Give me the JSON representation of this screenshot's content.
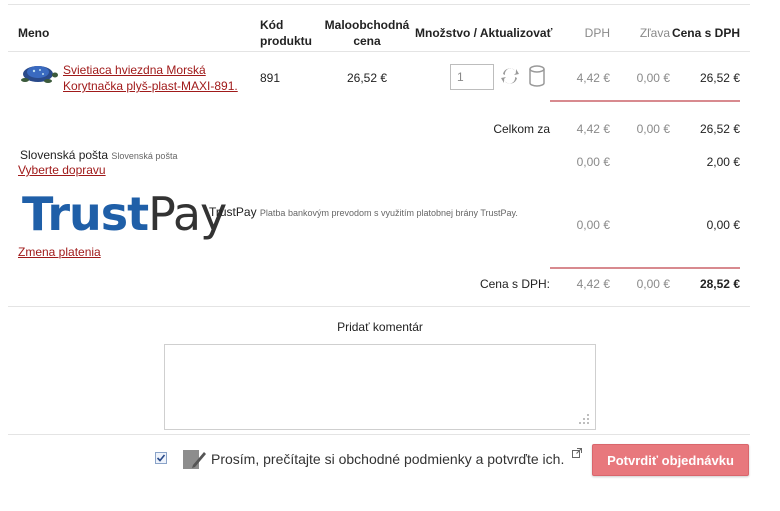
{
  "table": {
    "headers": {
      "name": "Meno",
      "code_l1": "Kód",
      "code_l2": "produktu",
      "price_l1": "Maloobchodná",
      "price_l2": "cena",
      "qty": "Množstvo / Aktualizovať",
      "vat": "DPH",
      "discount": "Zľava",
      "total": "Cena s DPH"
    },
    "item": {
      "name_l1": "Svietiaca hviezdna Morská",
      "name_l2": "Korytnačka plyš-plast-MAXI-891.",
      "code": "891",
      "price": "26,52 €",
      "qty": "1",
      "vat": "4,42 €",
      "discount": "0,00 €",
      "total": "26,52 €"
    }
  },
  "subtotal": {
    "label": "Celkom za",
    "vat": "4,42 €",
    "discount": "0,00 €",
    "total": "26,52 €"
  },
  "shipping": {
    "name": "Slovenská pošta",
    "desc": "Slovenská pošta",
    "link": "Vyberte dopravu",
    "vat": "0,00 €",
    "total": "2,00 €"
  },
  "payment": {
    "logo_trust": "Trust",
    "logo_pay": "Pay",
    "name": "TrustPay",
    "desc": "Platba bankovým prevodom s využitím platobnej brány TrustPay.",
    "link": "Zmena platenia",
    "vat": "0,00 €",
    "total": "0,00 €"
  },
  "grand": {
    "label": "Cena s DPH:",
    "vat": "4,42 €",
    "discount": "0,00 €",
    "total": "28,52 €"
  },
  "comment": {
    "label": "Pridať komentár"
  },
  "terms": {
    "text": "Prosím, prečítajte si obchodné podmienky a potvrďte ich.",
    "checked": true
  },
  "confirm_button": "Potvrdiť objednávku",
  "colors": {
    "accent": "#e8787d",
    "link": "#a01a1a",
    "trust_blue": "#1f5fa8"
  }
}
